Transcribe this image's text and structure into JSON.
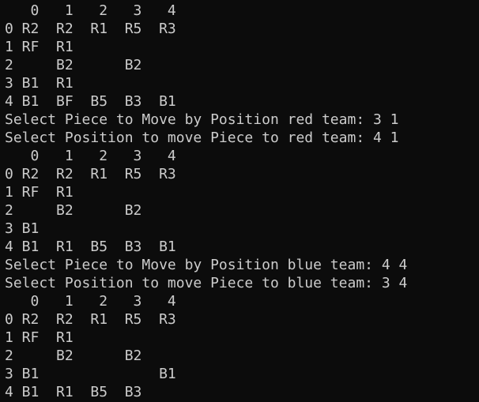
{
  "terminal": {
    "colors": {
      "background": "#0c0c0c",
      "foreground": "#cccccc"
    },
    "lines": [
      "   0   1   2   3   4",
      "0 R2  R2  R1  R5  R3",
      "1 RF  R1",
      "2     B2      B2",
      "3 B1  R1",
      "4 B1  BF  B5  B3  B1",
      "Select Piece to Move by Position red team: 3 1",
      "Select Position to move Piece to red team: 4 1",
      "   0   1   2   3   4",
      "0 R2  R2  R1  R5  R3",
      "1 RF  R1",
      "2     B2      B2",
      "3 B1",
      "4 B1  R1  B5  B3  B1",
      "Select Piece to Move by Position blue team: 4 4",
      "Select Position to move Piece to blue team: 3 4",
      "   0   1   2   3   4",
      "0 R2  R2  R1  R5  R3",
      "1 RF  R1",
      "2     B2      B2",
      "3 B1              B1",
      "4 B1  R1  B5  B3"
    ]
  }
}
